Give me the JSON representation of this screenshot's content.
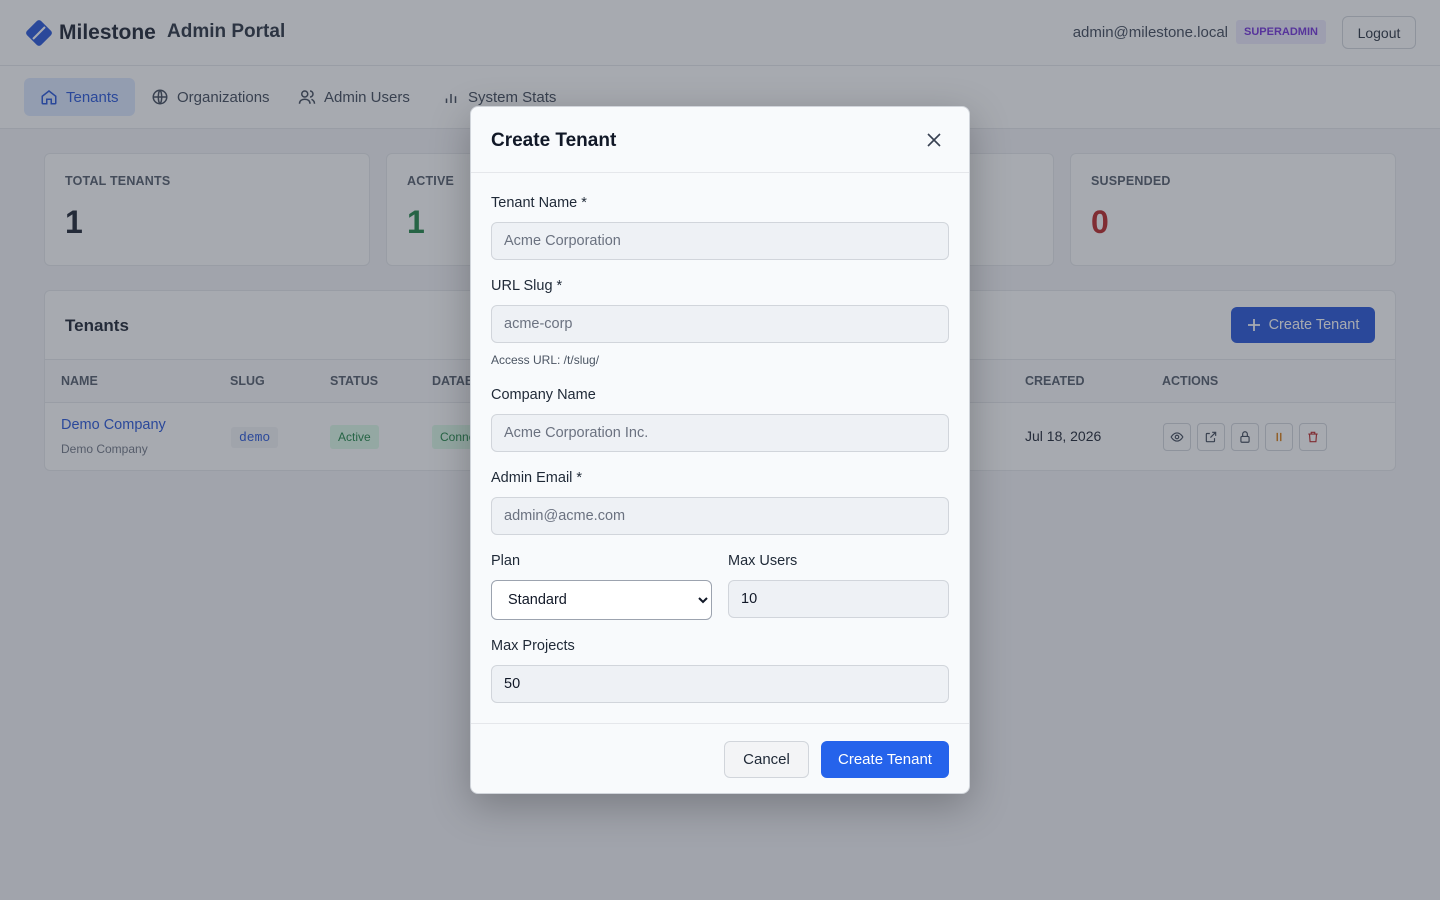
{
  "header": {
    "brand": "Milestone",
    "portal_title": "Admin Portal",
    "user_email": "admin@milestone.local",
    "role_badge": "SUPERADMIN",
    "logout_label": "Logout"
  },
  "nav": {
    "items": [
      {
        "label": "Tenants",
        "icon": "home-icon",
        "active": true
      },
      {
        "label": "Organizations",
        "icon": "globe-icon"
      },
      {
        "label": "Admin Users",
        "icon": "users-icon"
      },
      {
        "label": "System Stats",
        "icon": "bar-chart-icon"
      }
    ]
  },
  "stats": [
    {
      "label": "TOTAL TENANTS",
      "value": "1",
      "color": "#111827"
    },
    {
      "label": "ACTIVE",
      "value": "1",
      "color": "#15803d"
    },
    {
      "label": "SUSPENDED",
      "value": "0",
      "color": "#b91c1c"
    }
  ],
  "tenants": {
    "title": "Tenants",
    "create_label": "Create Tenant",
    "columns": [
      "NAME",
      "SLUG",
      "STATUS",
      "DATABASE",
      "CREATED",
      "ACTIONS"
    ],
    "rows": [
      {
        "name": "Demo Company",
        "company": "Demo Company",
        "slug": "demo",
        "status": "Active",
        "database": "Connected",
        "created": "Jul 18, 2026"
      }
    ]
  },
  "modal": {
    "title": "Create Tenant",
    "tenant_name": {
      "label": "Tenant Name *",
      "placeholder": "Acme Corporation"
    },
    "url_slug": {
      "label": "URL Slug *",
      "placeholder": "acme-corp",
      "hint": "Access URL: /t/slug/"
    },
    "company_name": {
      "label": "Company Name",
      "placeholder": "Acme Corporation Inc."
    },
    "admin_email": {
      "label": "Admin Email *",
      "placeholder": "admin@acme.com"
    },
    "plan": {
      "label": "Plan",
      "value": "Standard"
    },
    "max_users": {
      "label": "Max Users",
      "value": "10"
    },
    "max_projects": {
      "label": "Max Projects",
      "value": "50"
    },
    "cancel_label": "Cancel",
    "submit_label": "Create Tenant"
  },
  "colors": {
    "primary": "#2563eb",
    "success": "#15803d",
    "danger": "#b91c1c",
    "warning": "#d97706"
  }
}
